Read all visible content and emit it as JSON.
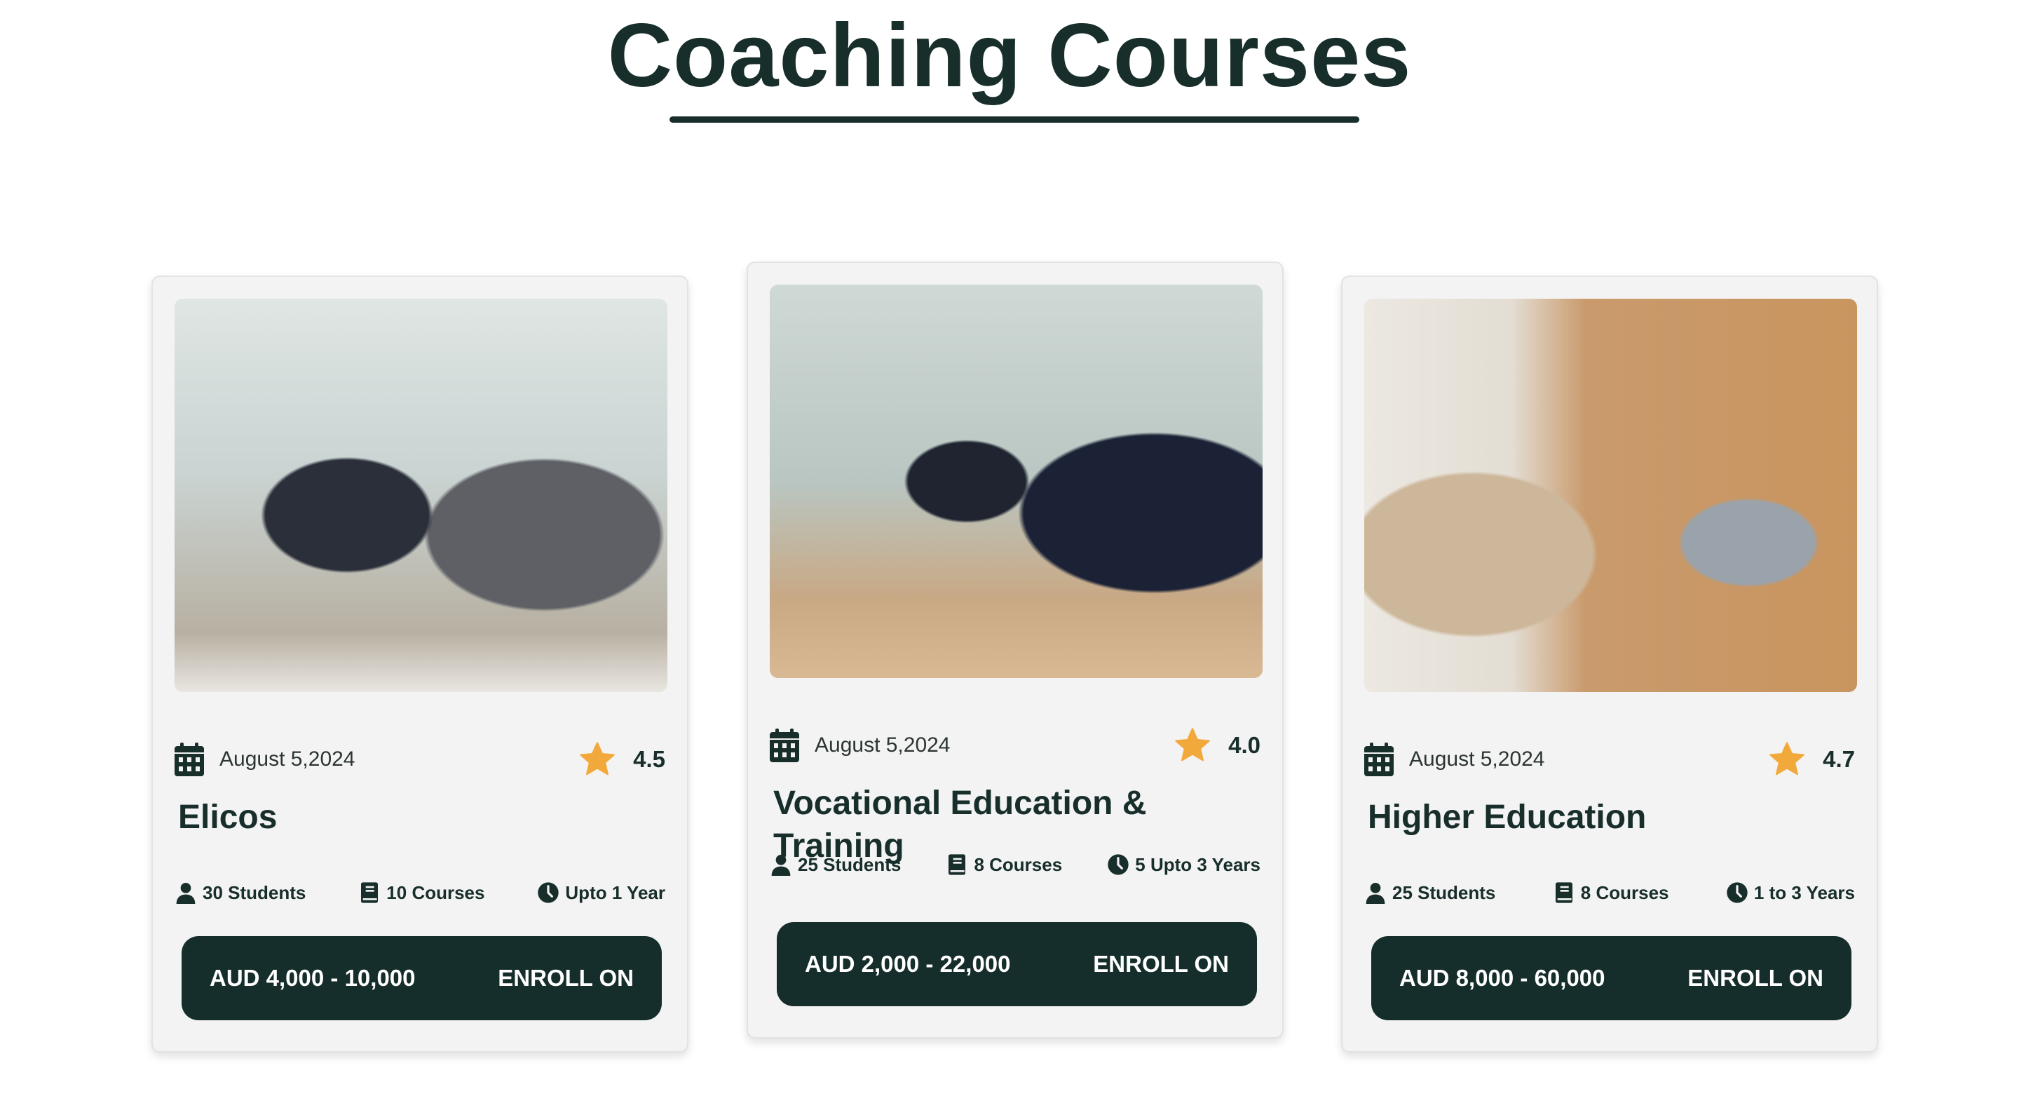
{
  "page": {
    "title": "Coaching Courses"
  },
  "colors": {
    "primary": "#162e2b",
    "star": "#f2a93b",
    "card_bg": "#f3f3f3"
  },
  "courses": [
    {
      "date": "August 5,2024",
      "rating": "4.5",
      "title": "Elicos",
      "students": "30 Students",
      "courses": "10 Courses",
      "duration": "Upto 1 Year",
      "price": "AUD 4,000 - 10,000",
      "cta": "ENROLL ON"
    },
    {
      "date": "August 5,2024",
      "rating": "4.0",
      "title": "Vocational Education & Training",
      "students": "25 Students",
      "courses": "8 Courses",
      "duration": "5 Upto 3 Years",
      "price": "AUD 2,000 - 22,000",
      "cta": "ENROLL ON"
    },
    {
      "date": "August 5,2024",
      "rating": "4.7",
      "title": "Higher Education",
      "students": "25 Students",
      "courses": "8 Courses",
      "duration": "1 to 3 Years",
      "price": "AUD 8,000 - 60,000",
      "cta": "ENROLL ON"
    }
  ]
}
